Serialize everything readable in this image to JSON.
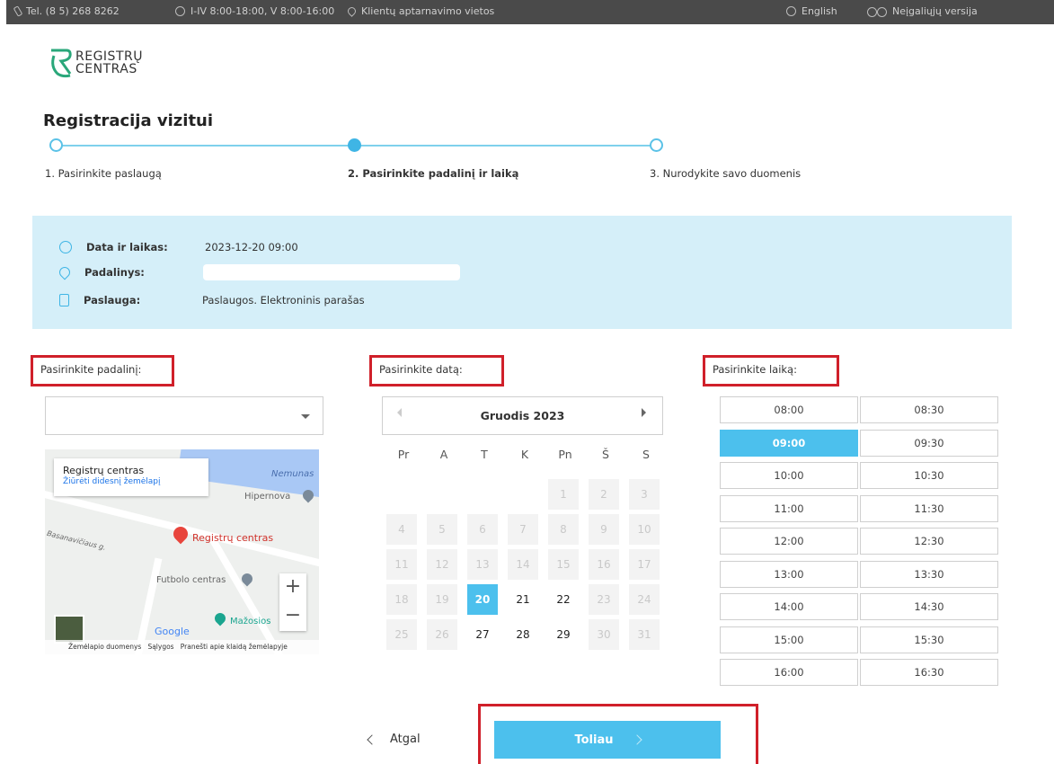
{
  "topbar": {
    "phone": "Tel. (8 5) 268 8262",
    "hours": "I-IV 8:00-18:00, V 8:00-16:00",
    "locations": "Klientų aptarnavimo vietos",
    "language": "English",
    "accessibility": "Neįgaliųjų versija"
  },
  "logo": {
    "line1": "REGISTRŲ",
    "line2": "CENTRAS"
  },
  "page": {
    "title": "Registracija vizitui"
  },
  "steps": [
    {
      "label": "1. Pasirinkite paslaugą",
      "active": false
    },
    {
      "label": "2. Pasirinkite padalinį ir laiką",
      "active": true
    },
    {
      "label": "3. Nurodykite savo duomenis",
      "active": false
    }
  ],
  "summary": {
    "datetime_label": "Data ir laikas:",
    "datetime_value": "2023-12-20 09:00",
    "branch_label": "Padalinys:",
    "branch_value": "",
    "service_label": "Paslauga:",
    "service_value": "Paslaugos. Elektroninis parašas"
  },
  "columns": {
    "branch_label": "Pasirinkite padalinį:",
    "date_label": "Pasirinkite datą:",
    "time_label": "Pasirinkite laiką:"
  },
  "branch_select": {
    "value": ""
  },
  "map": {
    "info_title": "Registrų centras",
    "info_link": "Žiūrėti didesnį žemėlapį",
    "water_label": "Nemunas",
    "poi_main": "Registrų centras",
    "poi_hipernova": "Hipernova",
    "poi_futbolo": "Futbolo centras",
    "poi_mazosios": "Mažosios",
    "street1": "J. Basanavičiaus g.",
    "zoom_in": "+",
    "zoom_out": "−",
    "google": "Google",
    "footer_data": "Žemėlapio duomenys",
    "footer_terms": "Sąlygos",
    "footer_report": "Pranešti apie klaidą žemėlapyje"
  },
  "calendar": {
    "month": "Gruodis 2023",
    "weekdays": [
      "Pr",
      "A",
      "T",
      "K",
      "Pn",
      "Š",
      "S"
    ],
    "selected_day": "20",
    "weeks": [
      [
        null,
        null,
        null,
        null,
        "1",
        "2",
        "3"
      ],
      [
        "4",
        "5",
        "6",
        "7",
        "8",
        "9",
        "10"
      ],
      [
        "11",
        "12",
        "13",
        "14",
        "15",
        "16",
        "17"
      ],
      [
        "18",
        "19",
        "20",
        "21",
        "22",
        "23",
        "24"
      ],
      [
        "25",
        "26",
        "27",
        "28",
        "29",
        "30",
        "31"
      ]
    ],
    "available_days": [
      "20",
      "21",
      "22",
      "27",
      "28",
      "29"
    ]
  },
  "times": {
    "selected": "09:00",
    "slots": [
      [
        "08:00",
        "08:30"
      ],
      [
        "09:00",
        "09:30"
      ],
      [
        "10:00",
        "10:30"
      ],
      [
        "11:00",
        "11:30"
      ],
      [
        "12:00",
        "12:30"
      ],
      [
        "13:00",
        "13:30"
      ],
      [
        "14:00",
        "14:30"
      ],
      [
        "15:00",
        "15:30"
      ],
      [
        "16:00",
        "16:30"
      ]
    ]
  },
  "nav": {
    "back_label": "Atgal",
    "next_label": "Toliau"
  },
  "colors": {
    "accent": "#4cc0ed",
    "summary_bg": "#d5eff9",
    "highlight_box": "#d0202a",
    "topbar_bg": "#4a4a4a"
  }
}
